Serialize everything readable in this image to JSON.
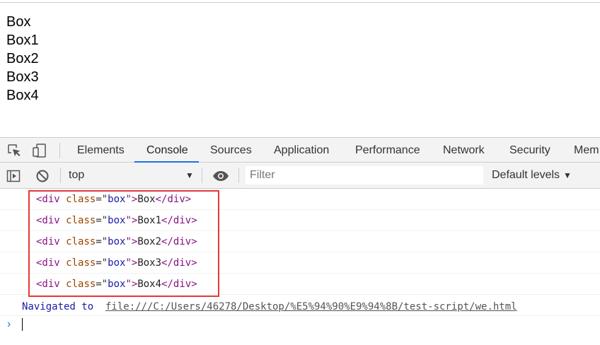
{
  "page": {
    "lines": [
      "Box",
      "Box1",
      "Box2",
      "Box3",
      "Box4"
    ]
  },
  "devtools": {
    "tabs": [
      "Elements",
      "Console",
      "Sources",
      "Application",
      "Performance",
      "Network",
      "Security",
      "Mem"
    ],
    "active_tab": "Console",
    "accent": "#1a73e8",
    "toolbar": {
      "context": "top",
      "filter_placeholder": "Filter",
      "levels": "Default levels"
    },
    "logs": [
      {
        "tag_open": "<div",
        "attr": "class",
        "eq": "=\"",
        "value": "box",
        "close_quote": "\">",
        "text": "Box",
        "tag_close": "</div>"
      },
      {
        "tag_open": "<div",
        "attr": "class",
        "eq": "=\"",
        "value": "box",
        "close_quote": "\">",
        "text": "Box1",
        "tag_close": "</div>"
      },
      {
        "tag_open": "<div",
        "attr": "class",
        "eq": "=\"",
        "value": "box",
        "close_quote": "\">",
        "text": "Box2",
        "tag_close": "</div>"
      },
      {
        "tag_open": "<div",
        "attr": "class",
        "eq": "=\"",
        "value": "box",
        "close_quote": "\">",
        "text": "Box3",
        "tag_close": "</div>"
      },
      {
        "tag_open": "<div",
        "attr": "class",
        "eq": "=\"",
        "value": "box",
        "close_quote": "\">",
        "text": "Box4",
        "tag_close": "</div>"
      }
    ],
    "navigation": {
      "label": "Navigated to",
      "url": "file:///C:/Users/46278/Desktop/%E5%94%90%E9%94%8B/test-script/we.html"
    },
    "prompt_glyph": "›",
    "highlight_color": "#e53935"
  }
}
